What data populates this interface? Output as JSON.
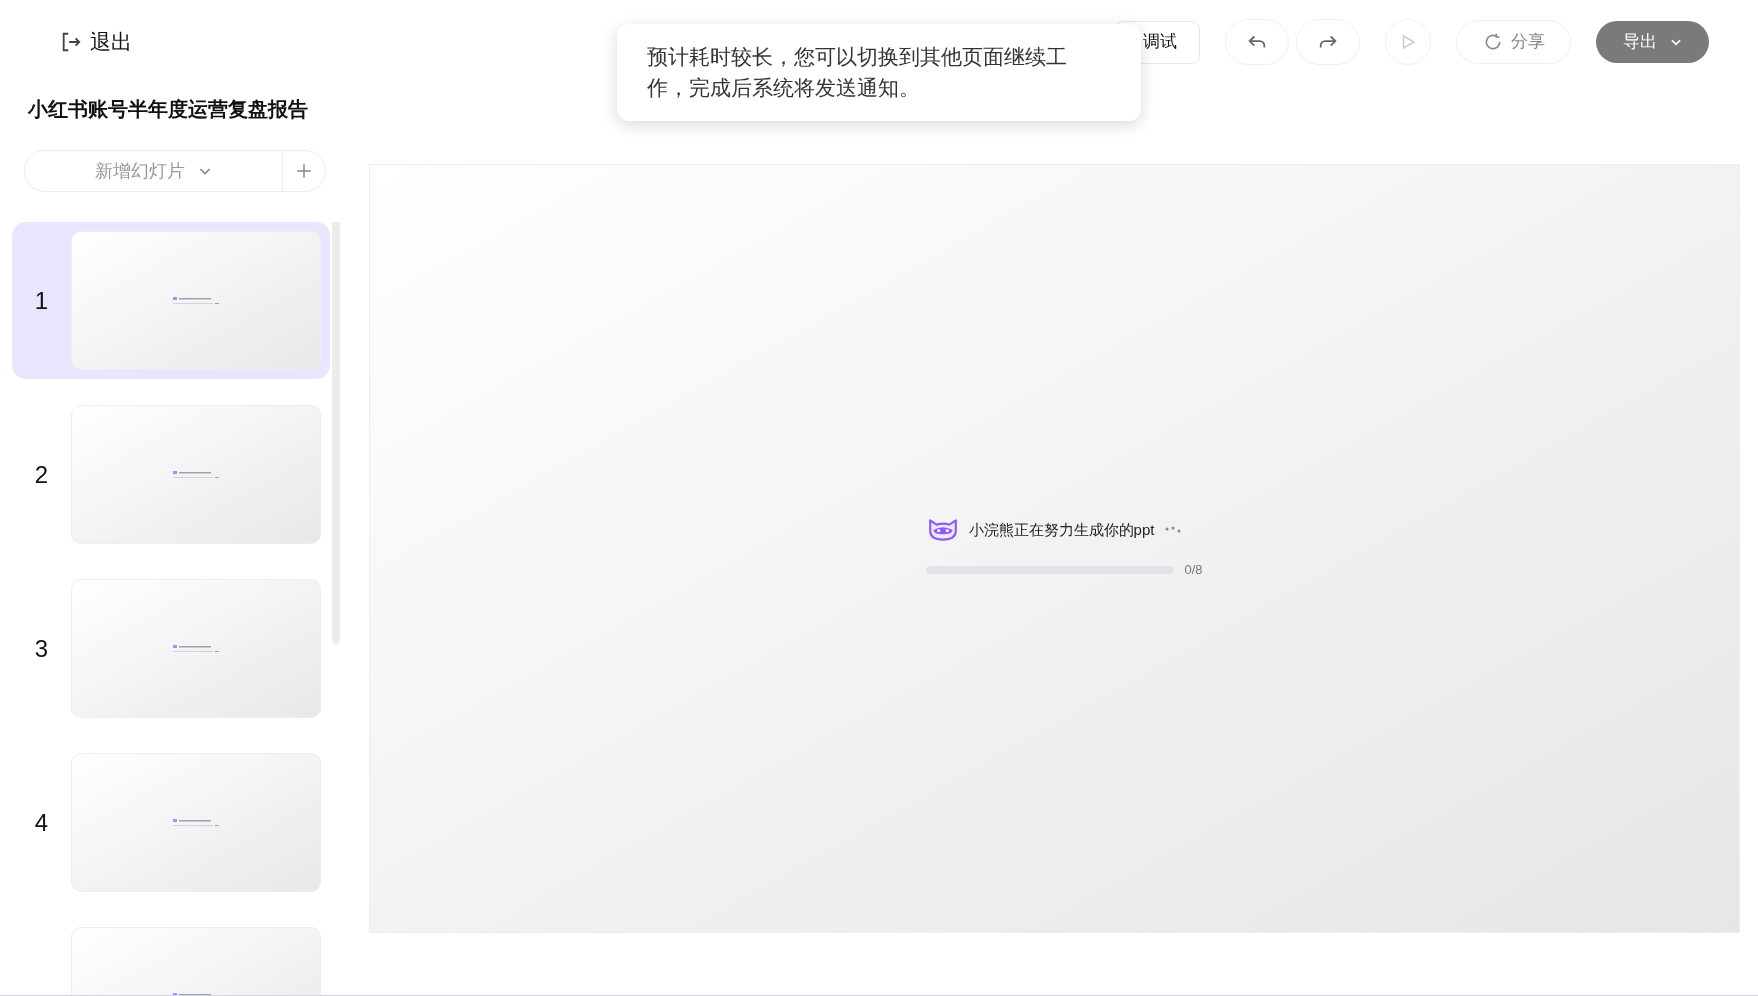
{
  "header": {
    "exit": "退出",
    "debug": "调试",
    "share": "分享",
    "export": "导出"
  },
  "toast": {
    "text": "预计耗时较长，您可以切换到其他页面继续工作，完成后系统将发送通知。"
  },
  "sidebar": {
    "title": "小红书账号半年度运营复盘报告",
    "new_slide": "新增幻灯片",
    "slides": [
      {
        "number": "1",
        "selected": true
      },
      {
        "number": "2",
        "selected": false
      },
      {
        "number": "3",
        "selected": false
      },
      {
        "number": "4",
        "selected": false
      },
      {
        "selected": false
      }
    ]
  },
  "canvas": {
    "status": "小浣熊正在努力生成你的ppt",
    "progress": {
      "level": 0,
      "reading": "0/8"
    }
  }
}
